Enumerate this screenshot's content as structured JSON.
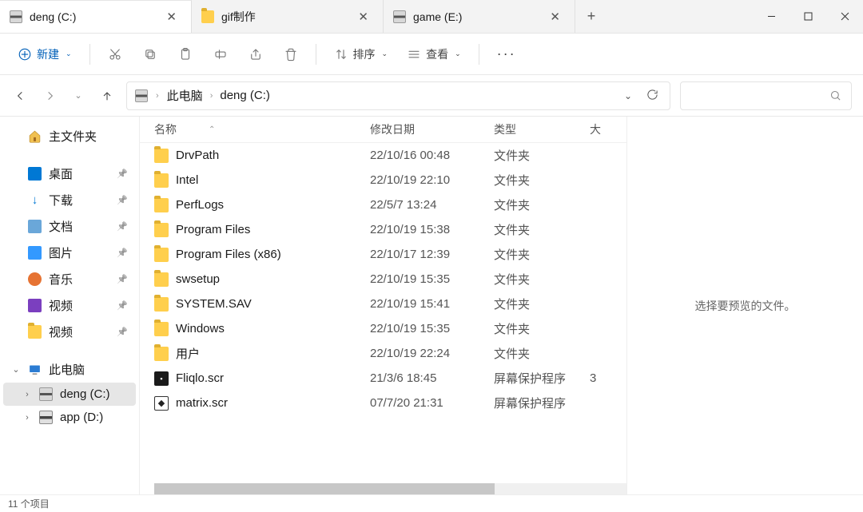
{
  "tabs": [
    {
      "label": "deng (C:)",
      "icon": "drive",
      "active": true
    },
    {
      "label": "gif制作",
      "icon": "folder",
      "active": false
    },
    {
      "label": "game (E:)",
      "icon": "drive",
      "active": false
    }
  ],
  "toolbar": {
    "new_label": "新建",
    "sort_label": "排序",
    "view_label": "查看"
  },
  "breadcrumbs": [
    "此电脑",
    "deng (C:)"
  ],
  "sidebar": {
    "home": "主文件夹",
    "quick": [
      {
        "label": "桌面",
        "icon": "blue"
      },
      {
        "label": "下载",
        "icon": "dl"
      },
      {
        "label": "文档",
        "icon": "doc"
      },
      {
        "label": "图片",
        "icon": "img"
      },
      {
        "label": "音乐",
        "icon": "music"
      },
      {
        "label": "视频",
        "icon": "vid"
      },
      {
        "label": "视频",
        "icon": "folder"
      }
    ],
    "pc": "此电脑",
    "drives": [
      {
        "label": "deng (C:)",
        "icon": "drive",
        "sel": true
      },
      {
        "label": "app (D:)",
        "icon": "drive2",
        "sel": false
      }
    ]
  },
  "columns": {
    "name": "名称",
    "date": "修改日期",
    "type": "类型",
    "size": "大"
  },
  "files": [
    {
      "name": "DrvPath",
      "date": "22/10/16 00:48",
      "type": "文件夹",
      "icon": "folder"
    },
    {
      "name": "Intel",
      "date": "22/10/19 22:10",
      "type": "文件夹",
      "icon": "folder"
    },
    {
      "name": "PerfLogs",
      "date": "22/5/7 13:24",
      "type": "文件夹",
      "icon": "folder"
    },
    {
      "name": "Program Files",
      "date": "22/10/19 15:38",
      "type": "文件夹",
      "icon": "folder"
    },
    {
      "name": "Program Files (x86)",
      "date": "22/10/17 12:39",
      "type": "文件夹",
      "icon": "folder"
    },
    {
      "name": "swsetup",
      "date": "22/10/19 15:35",
      "type": "文件夹",
      "icon": "folder"
    },
    {
      "name": "SYSTEM.SAV",
      "date": "22/10/19 15:41",
      "type": "文件夹",
      "icon": "folder"
    },
    {
      "name": "Windows",
      "date": "22/10/19 15:35",
      "type": "文件夹",
      "icon": "folder"
    },
    {
      "name": "用户",
      "date": "22/10/19 22:24",
      "type": "文件夹",
      "icon": "folder"
    },
    {
      "name": "Fliqlo.scr",
      "date": "21/3/6 18:45",
      "type": "屏幕保护程序",
      "size": "3",
      "icon": "scr"
    },
    {
      "name": "matrix.scr",
      "date": "07/7/20 21:31",
      "type": "屏幕保护程序",
      "icon": "scr2"
    }
  ],
  "preview": "选择要预览的文件。",
  "status": "11 个项目"
}
